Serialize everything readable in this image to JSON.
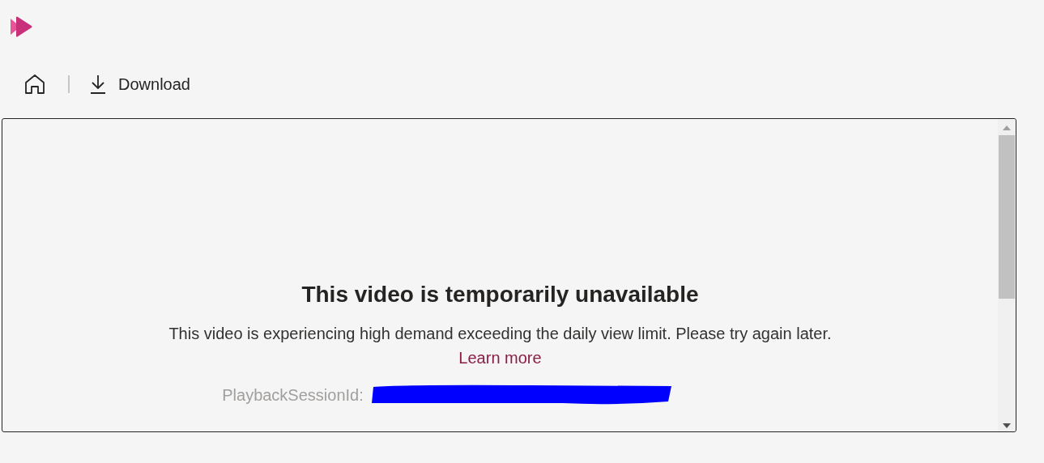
{
  "toolbar": {
    "download_label": "Download"
  },
  "message": {
    "title": "This video is temporarily unavailable",
    "body": "This video is experiencing high demand exceeding the daily view limit. Please try again later.",
    "link": "Learn more",
    "session_label": "PlaybackSessionId:"
  }
}
